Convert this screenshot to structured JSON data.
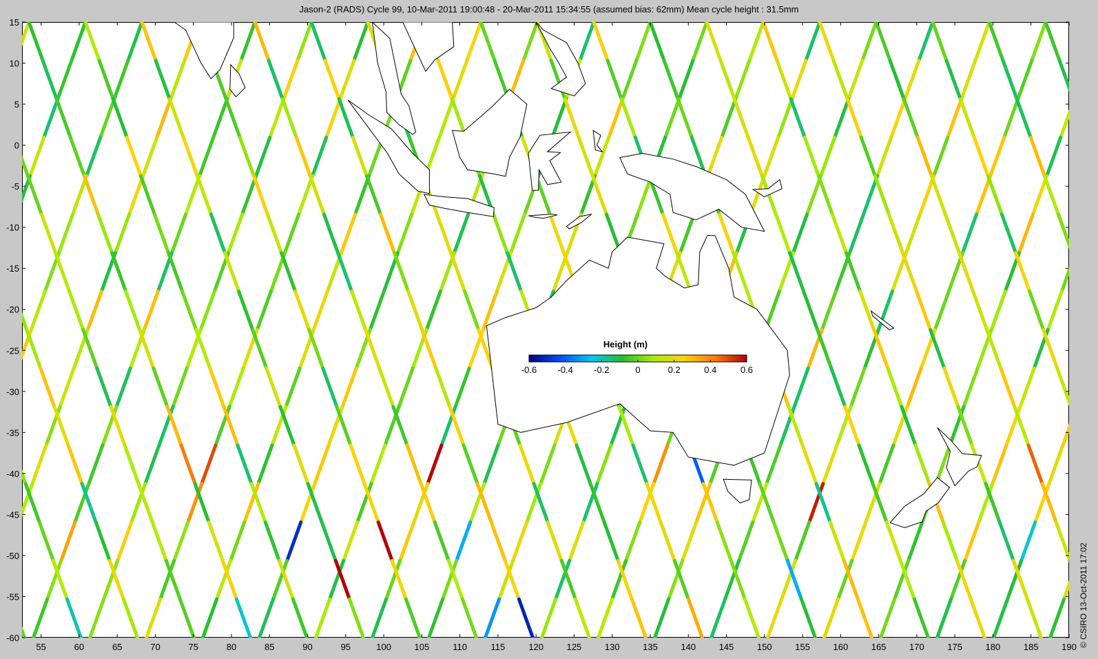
{
  "title": "Jason-2 (RADS) Cycle 99, 10-Mar-2011 19:00:48 - 20-Mar-2011 15:34:55 (assumed bias: 62mm)  Mean cycle height : 31.5mm",
  "copyright": "© CSIRO 13-Oct-2011 17:02",
  "axes": {
    "x_ticks": [
      55,
      60,
      65,
      70,
      75,
      80,
      85,
      90,
      95,
      100,
      105,
      110,
      115,
      120,
      125,
      130,
      135,
      140,
      145,
      150,
      155,
      160,
      165,
      170,
      175,
      180,
      185,
      190
    ],
    "y_ticks": [
      15,
      10,
      5,
      0,
      -5,
      -10,
      -15,
      -20,
      -25,
      -30,
      -35,
      -40,
      -45,
      -50,
      -55,
      -60
    ],
    "xlim": [
      52.5,
      190
    ],
    "ylim": [
      -60,
      15
    ]
  },
  "colorbar": {
    "label": "Height (m)",
    "ticks": [
      "-0.6",
      "-0.4",
      "-0.2",
      "0",
      "0.2",
      "0.4",
      "0.6"
    ],
    "range": [
      -0.6,
      0.6
    ],
    "colors": [
      "#00007f",
      "#0050ff",
      "#00c8ff",
      "#22c030",
      "#aaee00",
      "#ffd200",
      "#ff7800",
      "#b40000"
    ]
  },
  "land_color": "#ffffff",
  "coast_color": "#000000"
}
